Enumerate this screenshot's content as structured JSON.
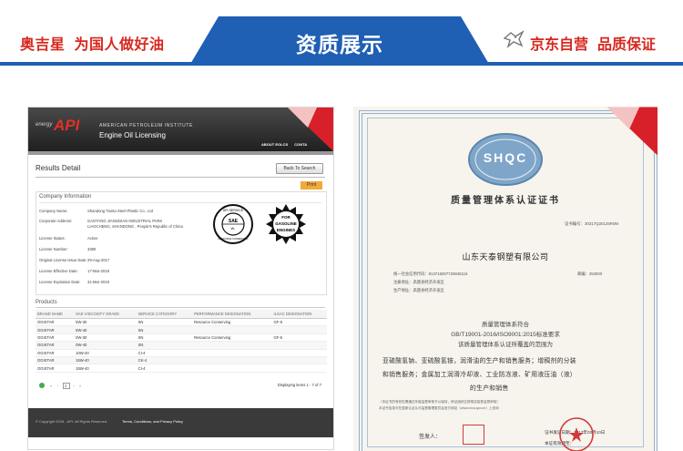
{
  "banner": {
    "left_slogan": [
      "奥吉星",
      "为国人做好油"
    ],
    "title": "资质展示",
    "right_slogan": [
      "京东自营",
      "品质保证"
    ],
    "accent": "#1f5fb4",
    "brand_red": "#d7281f"
  },
  "api_page": {
    "logo_prefix": "energy",
    "logo": "API",
    "institute": "AMERICAN PETROLEUM INSTITUTE",
    "program": "Engine Oil Licensing",
    "nav": [
      "ABOUT EOLCS",
      "CONTA"
    ],
    "results_title": "Results Detail",
    "back_button": "Back To Search",
    "print_button": "Print",
    "company_heading": "Company Information",
    "fields": [
      {
        "label": "Company Name:",
        "value": "Shandong Tianta Steel-Plastic Co., Ltd"
      },
      {
        "label": "Corporate Address:",
        "value": "GAOTANG JIANGDIAN INDUSTRIAL PARK"
      },
      {
        "label": "",
        "value": "LIAOCHENG, SHANDONG , People's Republic of China"
      },
      {
        "label": "License Status:",
        "value": "Active"
      },
      {
        "label": "License Number:",
        "value": "3380"
      },
      {
        "label": "Original License Issue Date:",
        "value": "29-Aug-2017"
      },
      {
        "label": "License Effective Date:",
        "value": "17-Mar-2018"
      },
      {
        "label": "License Expiration Date:",
        "value": "31-Mar-2019"
      }
    ],
    "donut_text": {
      "top": "API SERVICE",
      "center": "SAE",
      "center2": "W-",
      "bottom": "RESOURCE CONSERVING"
    },
    "starburst_text": [
      "FOR",
      "GASOLINE",
      "ENGINES"
    ],
    "products_heading": "Products",
    "columns": [
      "BRAND NAME",
      "SAE VISCOSITY GRADE",
      "SERVICE CATEGORY",
      "PERFORMANCE DESIGNATION",
      "ILSAC DESIGNATION"
    ],
    "rows": [
      [
        "OGISTAR",
        "5W-30",
        "SN",
        "Resource Conserving",
        "GF-5"
      ],
      [
        "OGISTAR",
        "5W-40",
        "SN",
        "",
        ""
      ],
      [
        "OGISTAR",
        "0W-30",
        "SN",
        "Resource Conserving",
        "GF-5"
      ],
      [
        "OGISTAR",
        "0W-40",
        "SN",
        "",
        ""
      ],
      [
        "OGISTAR",
        "10W-40",
        "CI-4",
        "",
        ""
      ],
      [
        "OGISTAR",
        "15W-40",
        "CK-4",
        "",
        ""
      ],
      [
        "OGISTAR",
        "15W-40",
        "CI-4",
        "",
        ""
      ]
    ],
    "pager_page": "1",
    "pager_info": "Displaying items 1 - 7 of 7",
    "copyright": "© Copyright 2018 - API. All Rights Reserved.",
    "terms": "Terms, Conditions, and Privacy Policy"
  },
  "certificate": {
    "badge": "SHQC",
    "title": "质量管理体系认证证书",
    "number": "证书编号：30317Q20125R0M",
    "company": "山东天泰钢塑有限公司",
    "info_lines": [
      "统一社会信用代码：91371500772084611​6",
      "注册地址：高唐县经济开发区",
      "生产地址：高唐县经济开发区"
    ],
    "postcode": "邮编：252800",
    "statement": [
      "质量管理体系符合",
      "GB/T19001-2016/ISO9001:2015标准要求",
      "该质量管理体系认证所覆盖的范围为"
    ],
    "scope": [
      "亚硫酸氢钠、亚硫酸氢铵，润滑油的生产和销售服务；增稠剂的分装",
      "和销售服务；金属加工润滑冷却液、工业防冻液、矿用液压油（液）",
      "的生产和销售"
    ],
    "footnotes": [
      "（本证书的有效性需通过年度监督审核予以保持，获证组织应按规定接受监督审核）",
      "本证书信息可在国家认证认可监督管理委员会官方网站（www.cnca.gov.cn）上查询"
    ],
    "signature_label": "签发人：",
    "issue_label": "证书发证日期：2017年03月10日",
    "valid_label": "本证有效期至："
  }
}
